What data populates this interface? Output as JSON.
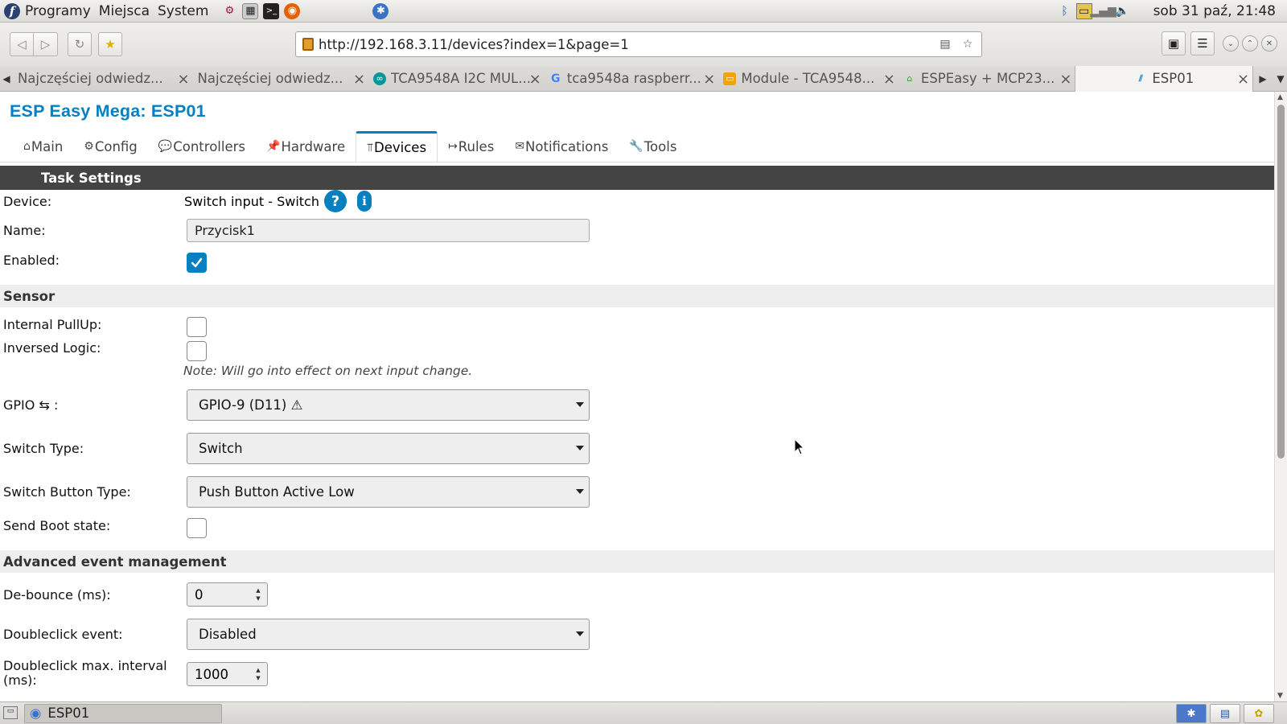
{
  "panel": {
    "menu": [
      "Programy",
      "Miejsca",
      "System"
    ],
    "clock": "sob 31 paź, 21:48"
  },
  "browser": {
    "url": "http://192.168.3.11/devices?index=1&page=1",
    "tabs": [
      {
        "label": "Najczęściej odwiedz...",
        "icon": "none"
      },
      {
        "label": "Najczęściej odwiedz...",
        "icon": "none"
      },
      {
        "label": "TCA9548A I2C MUL...",
        "icon": "arduino-icon"
      },
      {
        "label": "tca9548a raspberr...",
        "icon": "google-icon"
      },
      {
        "label": "Module - TCA9548...",
        "icon": "module-icon"
      },
      {
        "label": "ESPEasy + MCP23...",
        "icon": "home-icon"
      },
      {
        "label": "ESP01",
        "icon": "espeasy-icon",
        "active": true
      }
    ]
  },
  "page": {
    "site_title": "ESP Easy Mega: ESP01",
    "menu": [
      {
        "icon": "⌂",
        "label": "Main"
      },
      {
        "icon": "⚙",
        "label": "Config"
      },
      {
        "icon": "💬",
        "label": "Controllers"
      },
      {
        "icon": "📌",
        "label": "Hardware"
      },
      {
        "icon": "⫪",
        "label": "Devices",
        "active": true
      },
      {
        "icon": "↦",
        "label": "Rules"
      },
      {
        "icon": "✉",
        "label": "Notifications"
      },
      {
        "icon": "🔧",
        "label": "Tools"
      }
    ],
    "task_settings": "Task Settings",
    "device_label": "Device:",
    "device_value": "Switch input - Switch",
    "help_icon_text": "?",
    "info_icon_text": "i",
    "name_label": "Name:",
    "name_value": "Przycisk1",
    "enabled_label": "Enabled:",
    "enabled": true,
    "sensor_section": "Sensor",
    "pullup_label": "Internal PullUp:",
    "pullup": false,
    "inversed_label": "Inversed Logic:",
    "inversed": false,
    "note": "Note: Will go into effect on next input change.",
    "gpio_label": "GPIO ⇆ :",
    "gpio_value": "GPIO-9 (D11) ⚠",
    "switch_type_label": "Switch Type:",
    "switch_type_value": "Switch",
    "button_type_label": "Switch Button Type:",
    "button_type_value": "Push Button Active Low",
    "boot_label": "Send Boot state:",
    "boot_state": false,
    "advanced_section": "Advanced event management",
    "debounce_label": "De-bounce (ms):",
    "debounce_value": "0",
    "doubleclick_label": "Doubleclick event:",
    "doubleclick_value": "Disabled",
    "dc_interval_label_1": "Doubleclick max. interval",
    "dc_interval_label_2": "(ms):",
    "dc_interval_value": "1000"
  },
  "taskbar": {
    "window_label": "ESP01"
  }
}
